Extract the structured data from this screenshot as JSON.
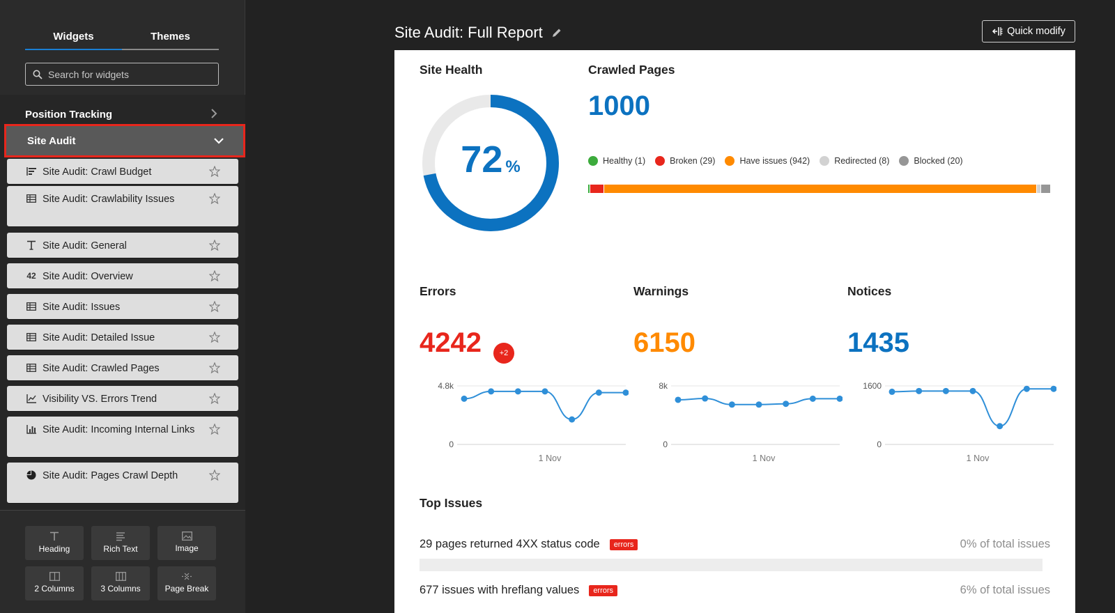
{
  "sidebar": {
    "tabs": [
      "Widgets",
      "Themes"
    ],
    "search_placeholder": "Search for widgets",
    "categories": {
      "position_tracking": "Position Tracking",
      "site_audit": "Site Audit"
    },
    "widgets": [
      {
        "label": "Site Audit: Crawl Budget",
        "icon": "bar-list-icon"
      },
      {
        "label": "Site Audit: Crawlability Issues",
        "icon": "table-icon"
      },
      {
        "label": "Site Audit: General",
        "icon": "text-icon"
      },
      {
        "label": "Site Audit: Overview",
        "icon": "number-icon",
        "icon_text": "42"
      },
      {
        "label": "Site Audit: Issues",
        "icon": "table-icon"
      },
      {
        "label": "Site Audit: Detailed Issue",
        "icon": "table-icon"
      },
      {
        "label": "Site Audit: Crawled Pages",
        "icon": "table-icon"
      },
      {
        "label": "Visibility VS. Errors Trend",
        "icon": "line-chart-icon"
      },
      {
        "label": "Site Audit: Incoming Internal Links",
        "icon": "bar-chart-icon"
      },
      {
        "label": "Site Audit: Pages Crawl Depth",
        "icon": "pie-chart-icon"
      }
    ],
    "blocks": [
      "Heading",
      "Rich Text",
      "Image",
      "2 Columns",
      "3 Columns",
      "Page Break"
    ]
  },
  "main": {
    "title": "Site Audit: Full Report",
    "quick_modify": "Quick modify",
    "site_health": {
      "label": "Site Health",
      "value": "72",
      "unit": "%",
      "percent": 72
    },
    "crawled_pages": {
      "label": "Crawled Pages",
      "value": "1000",
      "legend": [
        {
          "label": "Healthy (1)",
          "color": "#3cab3c",
          "count": 1
        },
        {
          "label": "Broken (29)",
          "color": "#e8261c",
          "count": 29
        },
        {
          "label": "Have issues (942)",
          "color": "#ff8a00",
          "count": 942
        },
        {
          "label": "Redirected (8)",
          "color": "#d2d2d2",
          "count": 8
        },
        {
          "label": "Blocked (20)",
          "color": "#969696",
          "count": 20
        }
      ]
    },
    "errors": {
      "label": "Errors",
      "value": "4242",
      "badge": "+2",
      "color": "#e8261c",
      "ymax_label": "4.8k",
      "ymin_label": "0",
      "x_label": "1 Nov",
      "ymax": 4800,
      "points": [
        3750,
        4350,
        4350,
        4350,
        2050,
        4250,
        4250
      ]
    },
    "warnings": {
      "label": "Warnings",
      "value": "6150",
      "color": "#ff8a00",
      "ymax_label": "8k",
      "ymin_label": "0",
      "x_label": "1 Nov",
      "ymax": 8000,
      "points": [
        6100,
        6280,
        5450,
        5450,
        5550,
        6250,
        6250
      ]
    },
    "notices": {
      "label": "Notices",
      "value": "1435",
      "color": "#0c72c0",
      "ymax_label": "1600",
      "ymin_label": "0",
      "x_label": "1 Nov",
      "ymax": 1600,
      "points": [
        1440,
        1460,
        1460,
        1460,
        500,
        1520,
        1520
      ]
    },
    "top_issues": {
      "label": "Top Issues",
      "items": [
        {
          "text": "29 pages returned 4XX status code",
          "tag": "errors",
          "pct": "0% of total issues"
        },
        {
          "text": "677 issues with hreflang values",
          "tag": "errors",
          "pct": "6% of total issues"
        }
      ]
    }
  },
  "colors": {
    "accent": "#0c72c0",
    "error": "#e8261c",
    "warning": "#ff8a00",
    "highlight": "#e8261c"
  }
}
